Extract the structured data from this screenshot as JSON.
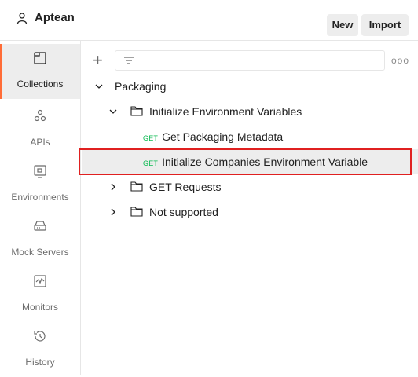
{
  "header": {
    "workspace_name": "Aptean",
    "new_label": "New",
    "import_label": "Import"
  },
  "sidebar": {
    "items": [
      {
        "label": "Collections",
        "icon": "collections-icon",
        "active": true
      },
      {
        "label": "APIs",
        "icon": "apis-icon"
      },
      {
        "label": "Environments",
        "icon": "environments-icon"
      },
      {
        "label": "Mock Servers",
        "icon": "mock-servers-icon"
      },
      {
        "label": "Monitors",
        "icon": "monitors-icon"
      },
      {
        "label": "History",
        "icon": "history-icon"
      }
    ]
  },
  "tree": {
    "collection": "Packaging",
    "folder_open": "Initialize Environment Variables",
    "requests": [
      {
        "method": "GET",
        "name": "Get Packaging Metadata"
      },
      {
        "method": "GET",
        "name": "Initialize Companies Environment Variable"
      }
    ],
    "folders_closed": [
      "GET Requests",
      "Not supported"
    ]
  },
  "colors": {
    "accent": "#ff6c37",
    "method_get": "#0cbb52",
    "highlight_box": "#e02020"
  }
}
